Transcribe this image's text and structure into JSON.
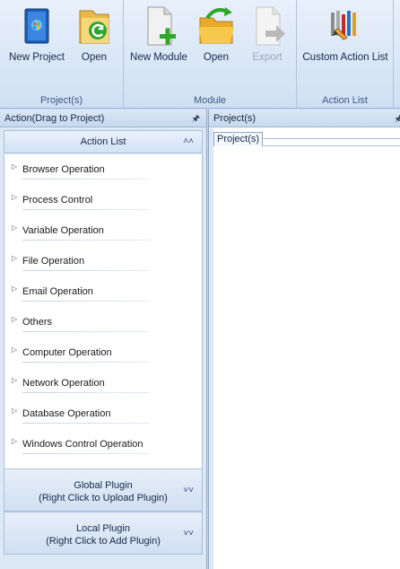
{
  "ribbon": {
    "groups": {
      "project": {
        "label": "Project(s)",
        "buttons": [
          {
            "label": "New Project",
            "icon": "new-project-icon"
          },
          {
            "label": "Open",
            "icon": "open-folder-icon"
          }
        ]
      },
      "module": {
        "label": "Module",
        "buttons": [
          {
            "label": "New Module",
            "icon": "new-module-icon"
          },
          {
            "label": "Open",
            "icon": "open-folder-icon"
          },
          {
            "label": "Export",
            "icon": "export-icon",
            "disabled": true
          }
        ]
      },
      "action_list": {
        "label": "Action List",
        "buttons": [
          {
            "label": "Custom Action List",
            "icon": "custom-action-list-icon"
          }
        ]
      }
    }
  },
  "left_panel": {
    "title": "Action(Drag to Project)",
    "action_list_header": "Action List",
    "categories": [
      "Browser Operation",
      "Process Control",
      "Variable Operation",
      "File Operation",
      "Email Operation",
      "Others",
      "Computer Operation",
      "Network Operation",
      "Database Operation",
      "Windows Control Operation"
    ],
    "global_plugin": {
      "line1": "Global Plugin",
      "line2": "(Right Click to Upload Plugin)"
    },
    "local_plugin": {
      "line1": "Local Plugin",
      "line2": "(Right Click to Add Plugin)"
    }
  },
  "right_panel": {
    "title": "Project(s)",
    "tab": "Project(s)"
  },
  "colors": {
    "ribbon_bg": "#dbe7f6",
    "panel_bg": "#dde8f6",
    "border": "#8fa8c8",
    "accent_green": "#2fa52a",
    "folder_yellow": "#f0b628"
  }
}
